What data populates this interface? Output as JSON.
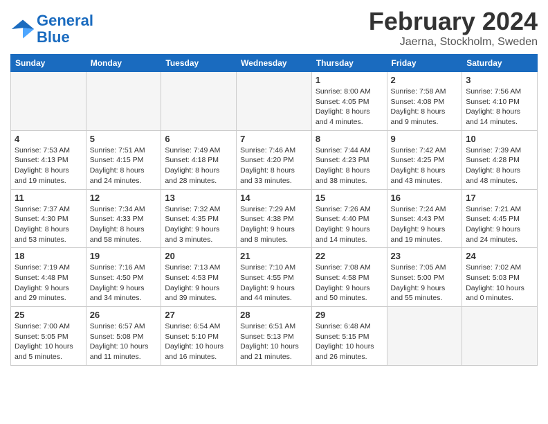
{
  "header": {
    "logo_line1": "General",
    "logo_line2": "Blue",
    "title": "February 2024",
    "subtitle": "Jaerna, Stockholm, Sweden"
  },
  "days_of_week": [
    "Sunday",
    "Monday",
    "Tuesday",
    "Wednesday",
    "Thursday",
    "Friday",
    "Saturday"
  ],
  "weeks": [
    [
      {
        "day": "",
        "info": ""
      },
      {
        "day": "",
        "info": ""
      },
      {
        "day": "",
        "info": ""
      },
      {
        "day": "",
        "info": ""
      },
      {
        "day": "1",
        "info": "Sunrise: 8:00 AM\nSunset: 4:05 PM\nDaylight: 8 hours\nand 4 minutes."
      },
      {
        "day": "2",
        "info": "Sunrise: 7:58 AM\nSunset: 4:08 PM\nDaylight: 8 hours\nand 9 minutes."
      },
      {
        "day": "3",
        "info": "Sunrise: 7:56 AM\nSunset: 4:10 PM\nDaylight: 8 hours\nand 14 minutes."
      }
    ],
    [
      {
        "day": "4",
        "info": "Sunrise: 7:53 AM\nSunset: 4:13 PM\nDaylight: 8 hours\nand 19 minutes."
      },
      {
        "day": "5",
        "info": "Sunrise: 7:51 AM\nSunset: 4:15 PM\nDaylight: 8 hours\nand 24 minutes."
      },
      {
        "day": "6",
        "info": "Sunrise: 7:49 AM\nSunset: 4:18 PM\nDaylight: 8 hours\nand 28 minutes."
      },
      {
        "day": "7",
        "info": "Sunrise: 7:46 AM\nSunset: 4:20 PM\nDaylight: 8 hours\nand 33 minutes."
      },
      {
        "day": "8",
        "info": "Sunrise: 7:44 AM\nSunset: 4:23 PM\nDaylight: 8 hours\nand 38 minutes."
      },
      {
        "day": "9",
        "info": "Sunrise: 7:42 AM\nSunset: 4:25 PM\nDaylight: 8 hours\nand 43 minutes."
      },
      {
        "day": "10",
        "info": "Sunrise: 7:39 AM\nSunset: 4:28 PM\nDaylight: 8 hours\nand 48 minutes."
      }
    ],
    [
      {
        "day": "11",
        "info": "Sunrise: 7:37 AM\nSunset: 4:30 PM\nDaylight: 8 hours\nand 53 minutes."
      },
      {
        "day": "12",
        "info": "Sunrise: 7:34 AM\nSunset: 4:33 PM\nDaylight: 8 hours\nand 58 minutes."
      },
      {
        "day": "13",
        "info": "Sunrise: 7:32 AM\nSunset: 4:35 PM\nDaylight: 9 hours\nand 3 minutes."
      },
      {
        "day": "14",
        "info": "Sunrise: 7:29 AM\nSunset: 4:38 PM\nDaylight: 9 hours\nand 8 minutes."
      },
      {
        "day": "15",
        "info": "Sunrise: 7:26 AM\nSunset: 4:40 PM\nDaylight: 9 hours\nand 14 minutes."
      },
      {
        "day": "16",
        "info": "Sunrise: 7:24 AM\nSunset: 4:43 PM\nDaylight: 9 hours\nand 19 minutes."
      },
      {
        "day": "17",
        "info": "Sunrise: 7:21 AM\nSunset: 4:45 PM\nDaylight: 9 hours\nand 24 minutes."
      }
    ],
    [
      {
        "day": "18",
        "info": "Sunrise: 7:19 AM\nSunset: 4:48 PM\nDaylight: 9 hours\nand 29 minutes."
      },
      {
        "day": "19",
        "info": "Sunrise: 7:16 AM\nSunset: 4:50 PM\nDaylight: 9 hours\nand 34 minutes."
      },
      {
        "day": "20",
        "info": "Sunrise: 7:13 AM\nSunset: 4:53 PM\nDaylight: 9 hours\nand 39 minutes."
      },
      {
        "day": "21",
        "info": "Sunrise: 7:10 AM\nSunset: 4:55 PM\nDaylight: 9 hours\nand 44 minutes."
      },
      {
        "day": "22",
        "info": "Sunrise: 7:08 AM\nSunset: 4:58 PM\nDaylight: 9 hours\nand 50 minutes."
      },
      {
        "day": "23",
        "info": "Sunrise: 7:05 AM\nSunset: 5:00 PM\nDaylight: 9 hours\nand 55 minutes."
      },
      {
        "day": "24",
        "info": "Sunrise: 7:02 AM\nSunset: 5:03 PM\nDaylight: 10 hours\nand 0 minutes."
      }
    ],
    [
      {
        "day": "25",
        "info": "Sunrise: 7:00 AM\nSunset: 5:05 PM\nDaylight: 10 hours\nand 5 minutes."
      },
      {
        "day": "26",
        "info": "Sunrise: 6:57 AM\nSunset: 5:08 PM\nDaylight: 10 hours\nand 11 minutes."
      },
      {
        "day": "27",
        "info": "Sunrise: 6:54 AM\nSunset: 5:10 PM\nDaylight: 10 hours\nand 16 minutes."
      },
      {
        "day": "28",
        "info": "Sunrise: 6:51 AM\nSunset: 5:13 PM\nDaylight: 10 hours\nand 21 minutes."
      },
      {
        "day": "29",
        "info": "Sunrise: 6:48 AM\nSunset: 5:15 PM\nDaylight: 10 hours\nand 26 minutes."
      },
      {
        "day": "",
        "info": ""
      },
      {
        "day": "",
        "info": ""
      }
    ]
  ]
}
